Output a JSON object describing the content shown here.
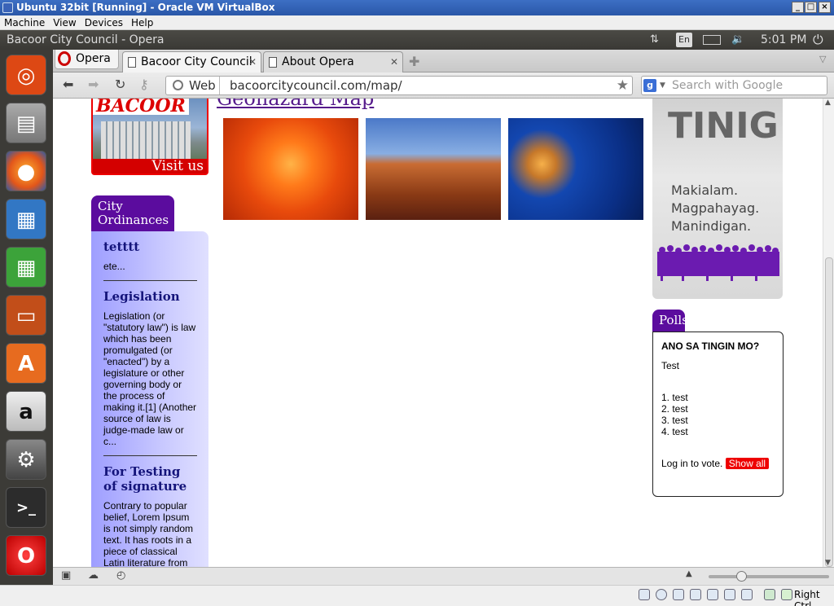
{
  "vbox": {
    "title": "Ubuntu 32bit [Running] - Oracle VM VirtualBox",
    "menu": [
      "Machine",
      "View",
      "Devices",
      "Help"
    ],
    "host_key": "Right Ctrl"
  },
  "ubuntu_panel": {
    "window_title": "Bacoor City Council - Opera",
    "keyboard": "En",
    "time": "5:01 PM"
  },
  "launcher": {
    "items": [
      "Ubuntu Dash",
      "Files",
      "Firefox",
      "LibreOffice Writer",
      "LibreOffice Calc",
      "LibreOffice Impress",
      "Ubuntu Software Center",
      "Amazon",
      "System Settings",
      "Terminal",
      "Opera"
    ]
  },
  "browser": {
    "menu_label": "Opera",
    "tabs": [
      {
        "label": "Bacoor City Council",
        "active": true
      },
      {
        "label": "About Opera",
        "active": false
      }
    ],
    "address_prefix": "Web",
    "url": "bacoorcitycouncil.com/map/",
    "search_placeholder": "Search with Google"
  },
  "page": {
    "banner_logo": "BACOOR",
    "banner_visit": "Visit us",
    "title": "Geohazard Map",
    "ordinances": {
      "tab": "City Ordinances",
      "items": [
        {
          "title": "tetttt",
          "text": "ete..."
        },
        {
          "title": "Legislation",
          "text": "Legislation (or \"statutory law\") is law which has been promulgated (or \"enacted\") by a legislature or other governing body or the process of making it.[1] (Another source of law is judge-made law or c..."
        },
        {
          "title": "For Testing of signature",
          "text": "Contrary to popular belief, Lorem Ipsum is not simply random text. It has roots in a piece of classical Latin literature from"
        }
      ]
    },
    "ad": {
      "title": "TINIG",
      "lines": [
        "Makialam.",
        "Magpahayag.",
        "Manindigan."
      ]
    },
    "polls": {
      "tab": "Polls",
      "question": "ANO SA TINGIN MO?",
      "subtitle": "Test",
      "options": [
        "1. test",
        "2. test",
        "3. test",
        "4. test"
      ],
      "login": "Log in to vote.",
      "show_all": "Show all"
    }
  }
}
